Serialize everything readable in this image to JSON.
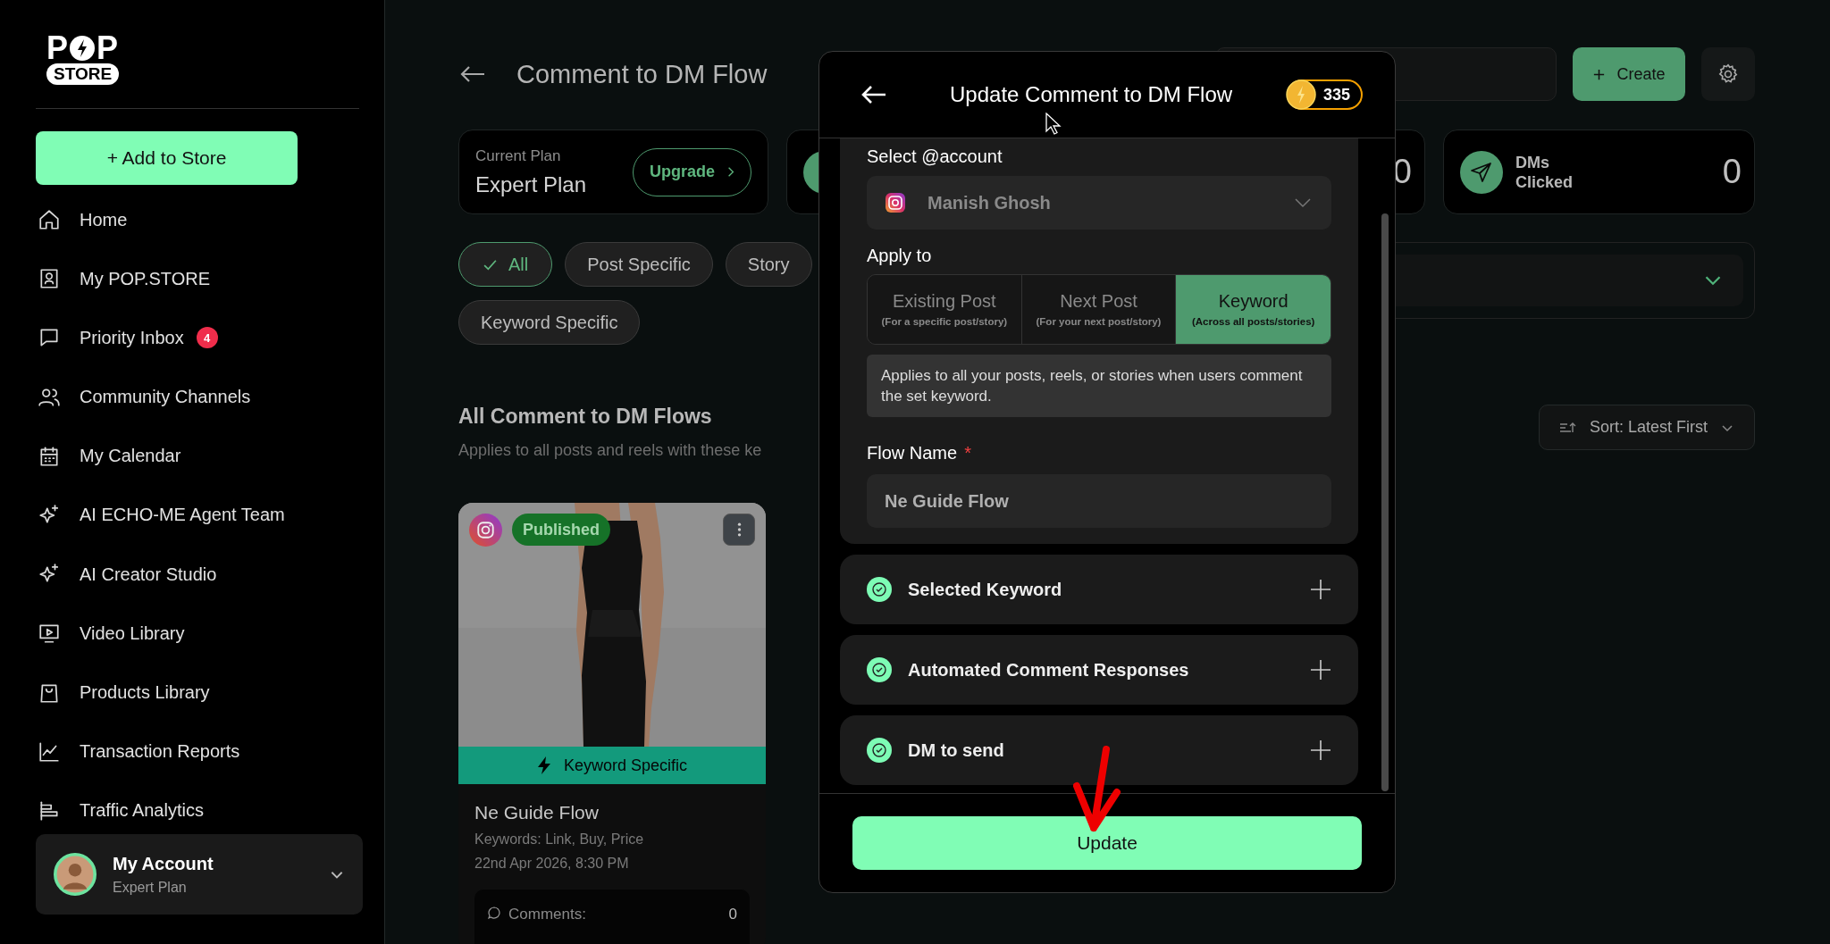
{
  "sidebar": {
    "logo": {
      "first": "P",
      "last": "P",
      "badge": "STORE"
    },
    "add_button": "+ Add to Store",
    "nav": [
      {
        "label": "Home",
        "selected": false
      },
      {
        "label": "My POP.STORE",
        "selected": false
      },
      {
        "label": "Priority Inbox",
        "badge": "4",
        "selected": false
      },
      {
        "label": "Community Channels",
        "selected": false
      },
      {
        "label": "My Calendar",
        "selected": false
      },
      {
        "label": "AI ECHO-ME Agent Team",
        "selected": false
      },
      {
        "label": "AI Creator Studio",
        "selected": false
      },
      {
        "label": "Video Library",
        "selected": false
      },
      {
        "label": "Products Library",
        "selected": false
      },
      {
        "label": "Transaction Reports",
        "selected": false
      },
      {
        "label": "Traffic Analytics",
        "selected": false
      }
    ],
    "account": {
      "name": "My Account",
      "plan": "Expert Plan"
    }
  },
  "main": {
    "title": "Comment to DM Flow",
    "create_button": "Create",
    "plan_card": {
      "label": "Current Plan",
      "plan": "Expert Plan",
      "upgrade": "Upgrade"
    },
    "stats": [
      {
        "value": "0"
      },
      {
        "label": "DMs Clicked",
        "value": "0"
      }
    ],
    "filters": [
      {
        "label": "All",
        "selected": true
      },
      {
        "label": "Post Specific",
        "selected": false
      },
      {
        "label": "Story",
        "selected": false
      },
      {
        "label": "Keyword Specific",
        "selected": false
      }
    ],
    "section": {
      "title": "All Comment to DM Flows",
      "subtitle": "Applies to all posts and reels with these ke",
      "sort": "Sort: Latest First"
    },
    "flows": [
      {
        "status": "Published",
        "type": "Keyword Specific",
        "name": "Ne Guide Flow",
        "keywords": "Keywords: Link, Buy, Price",
        "date": "22nd Apr 2026, 8:30 PM",
        "comments_label": "Comments:",
        "comments": "0"
      }
    ]
  },
  "modal": {
    "title": "Update Comment to DM Flow",
    "credits": "335",
    "account_label": "Select @account",
    "account": "Manish Ghosh",
    "apply_label": "Apply to",
    "apply_options": [
      {
        "label": "Existing Post",
        "hint": "(For a specific post/story)",
        "selected": false
      },
      {
        "label": "Next Post",
        "hint": "(For your next post/story)",
        "selected": false
      },
      {
        "label": "Keyword",
        "hint": "(Across all posts/stories)",
        "selected": true
      }
    ],
    "apply_info": "Applies to all your posts, reels, or stories when users comment the set keyword.",
    "flow_name_label": "Flow Name",
    "required_mark": "*",
    "flow_name": "Ne Guide Flow",
    "sections": [
      {
        "label": "Selected Keyword",
        "done": true
      },
      {
        "label": "Automated Comment Responses",
        "done": true
      },
      {
        "label": "DM to send",
        "done": true
      }
    ],
    "submit": "Update"
  }
}
